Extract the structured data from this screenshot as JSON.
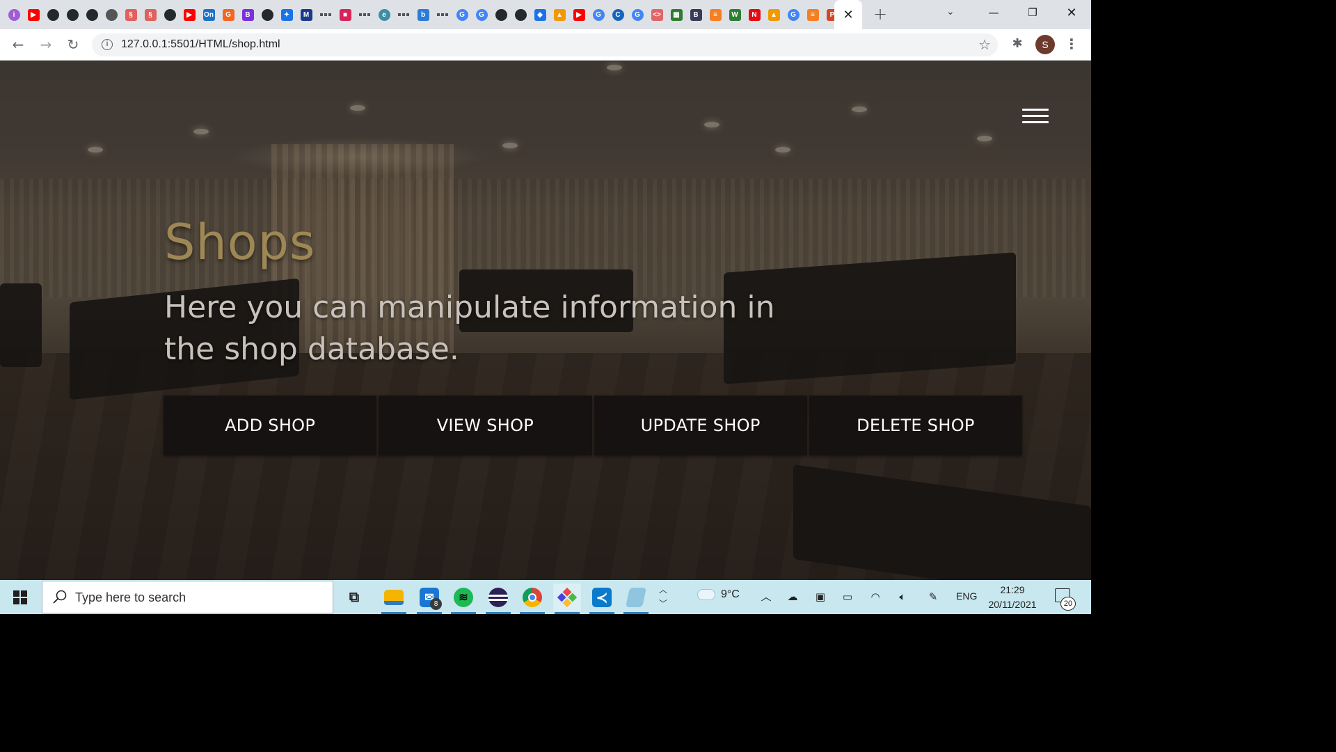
{
  "browser": {
    "tab_favicons": [
      {
        "icon": "info-icon",
        "color": "#a05cd6",
        "glyph": "i",
        "round": true
      },
      {
        "icon": "youtube-icon",
        "color": "#ff0000",
        "glyph": "▶"
      },
      {
        "icon": "github-icon",
        "color": "#24292e",
        "glyph": "",
        "round": true
      },
      {
        "icon": "github-icon",
        "color": "#24292e",
        "glyph": "",
        "round": true
      },
      {
        "icon": "github-icon",
        "color": "#24292e",
        "glyph": "",
        "round": true
      },
      {
        "icon": "globe-icon",
        "color": "#555555",
        "glyph": "",
        "round": true
      },
      {
        "icon": "openai-icon",
        "color": "#e0605b",
        "glyph": "§"
      },
      {
        "icon": "openai-icon",
        "color": "#e0605b",
        "glyph": "§"
      },
      {
        "icon": "github-icon",
        "color": "#24292e",
        "glyph": "",
        "round": true
      },
      {
        "icon": "youtube-icon",
        "color": "#ff0000",
        "glyph": "▶"
      },
      {
        "icon": "on-icon",
        "color": "#1a73c8",
        "glyph": "On"
      },
      {
        "icon": "g-orange-icon",
        "color": "#f26722",
        "glyph": "G"
      },
      {
        "icon": "b-purple-icon",
        "color": "#7b2fe0",
        "glyph": "B"
      },
      {
        "icon": "github-icon",
        "color": "#24292e",
        "glyph": "",
        "round": true
      },
      {
        "icon": "gear-icon",
        "color": "#1a73e8",
        "glyph": "✦"
      },
      {
        "icon": "mdn-icon",
        "color": "#1b3a8c",
        "glyph": "M"
      },
      {
        "icon": "dashes-icon",
        "dash": true
      },
      {
        "icon": "square-icon",
        "color": "#d6245b",
        "glyph": "■"
      },
      {
        "icon": "dashes-icon",
        "dash": true
      },
      {
        "icon": "edge-icon",
        "color": "#3b8ea5",
        "glyph": "e",
        "round": true
      },
      {
        "icon": "dashes-icon",
        "dash": true
      },
      {
        "icon": "bing-icon",
        "color": "#2c7bd6",
        "glyph": "b"
      },
      {
        "icon": "dashes-icon",
        "dash": true
      },
      {
        "icon": "google-icon",
        "color": "#4285f4",
        "glyph": "G",
        "round": true
      },
      {
        "icon": "google-icon",
        "color": "#4285f4",
        "glyph": "G",
        "round": true
      },
      {
        "icon": "github-icon",
        "color": "#24292e",
        "glyph": "",
        "round": true
      },
      {
        "icon": "github-icon",
        "color": "#24292e",
        "glyph": "",
        "round": true
      },
      {
        "icon": "diamond-icon",
        "color": "#1a73e8",
        "glyph": "◆"
      },
      {
        "icon": "drive-icon",
        "color": "#f29900",
        "glyph": "▲"
      },
      {
        "icon": "youtube-icon",
        "color": "#ff0000",
        "glyph": "▶"
      },
      {
        "icon": "google-icon",
        "color": "#4285f4",
        "glyph": "G",
        "round": true
      },
      {
        "icon": "c-icon",
        "color": "#1565c0",
        "glyph": "C",
        "round": true
      },
      {
        "icon": "google-icon",
        "color": "#4285f4",
        "glyph": "G",
        "round": true
      },
      {
        "icon": "code-icon",
        "color": "#e06666",
        "glyph": "<>"
      },
      {
        "icon": "colors-icon",
        "color": "#2e7d32",
        "glyph": "▦"
      },
      {
        "icon": "b-dark-icon",
        "color": "#3a3a5a",
        "glyph": "B"
      },
      {
        "icon": "stackoverflow-icon",
        "color": "#f48024",
        "glyph": "≡"
      },
      {
        "icon": "w-icon",
        "color": "#2e7d32",
        "glyph": "W"
      },
      {
        "icon": "netflix-icon",
        "color": "#e50914",
        "glyph": "N"
      },
      {
        "icon": "drive-icon",
        "color": "#f29900",
        "glyph": "▲"
      },
      {
        "icon": "google-icon",
        "color": "#4285f4",
        "glyph": "G",
        "round": true
      },
      {
        "icon": "stackoverflow-icon",
        "color": "#f48024",
        "glyph": "≡"
      },
      {
        "icon": "powerpoint-icon",
        "color": "#d24726",
        "glyph": "P"
      }
    ],
    "active_tab_close": "✕",
    "new_tab": "+",
    "tab_search": "⌄",
    "window_min": "—",
    "window_max": "❐",
    "window_close": "✕",
    "back": "←",
    "forward": "→",
    "reload": "↻",
    "url": "127.0.0.1:5501/HTML/shop.html",
    "star": "☆",
    "extensions": "✱",
    "profile_initial": "S",
    "menu": "⋮"
  },
  "page": {
    "title": "Shops",
    "subtitle": "Here you can manipulate information in the shop database.",
    "actions": [
      "ADD SHOP",
      "VIEW SHOP",
      "UPDATE SHOP",
      "DELETE SHOP"
    ]
  },
  "taskbar": {
    "search_placeholder": "Type here to search",
    "mail_badge": "8",
    "weather_temp": "9°C",
    "language": "ENG",
    "time": "21:29",
    "date": "20/11/2021",
    "notification_count": "20",
    "apps": [
      {
        "name": "task-view-icon",
        "color": "transparent",
        "glyph": "▭"
      },
      {
        "name": "file-explorer-icon",
        "color": "#f4b400",
        "glyph": "▬"
      },
      {
        "name": "mail-icon",
        "color": "#1976d2",
        "glyph": "✉"
      },
      {
        "name": "spotify-icon",
        "color": "#1db954",
        "glyph": "≋"
      },
      {
        "name": "eclipse-icon",
        "color": "#2c2255",
        "glyph": "◑"
      },
      {
        "name": "chrome-icon",
        "color": "#db4437",
        "glyph": "◉"
      },
      {
        "name": "gitkraken-icon",
        "color": "#179287",
        "glyph": "◈"
      },
      {
        "name": "vscode-icon",
        "color": "#0a7acc",
        "glyph": "≺"
      },
      {
        "name": "notepad-icon",
        "color": "#6aa9c4",
        "glyph": "▱"
      }
    ]
  }
}
